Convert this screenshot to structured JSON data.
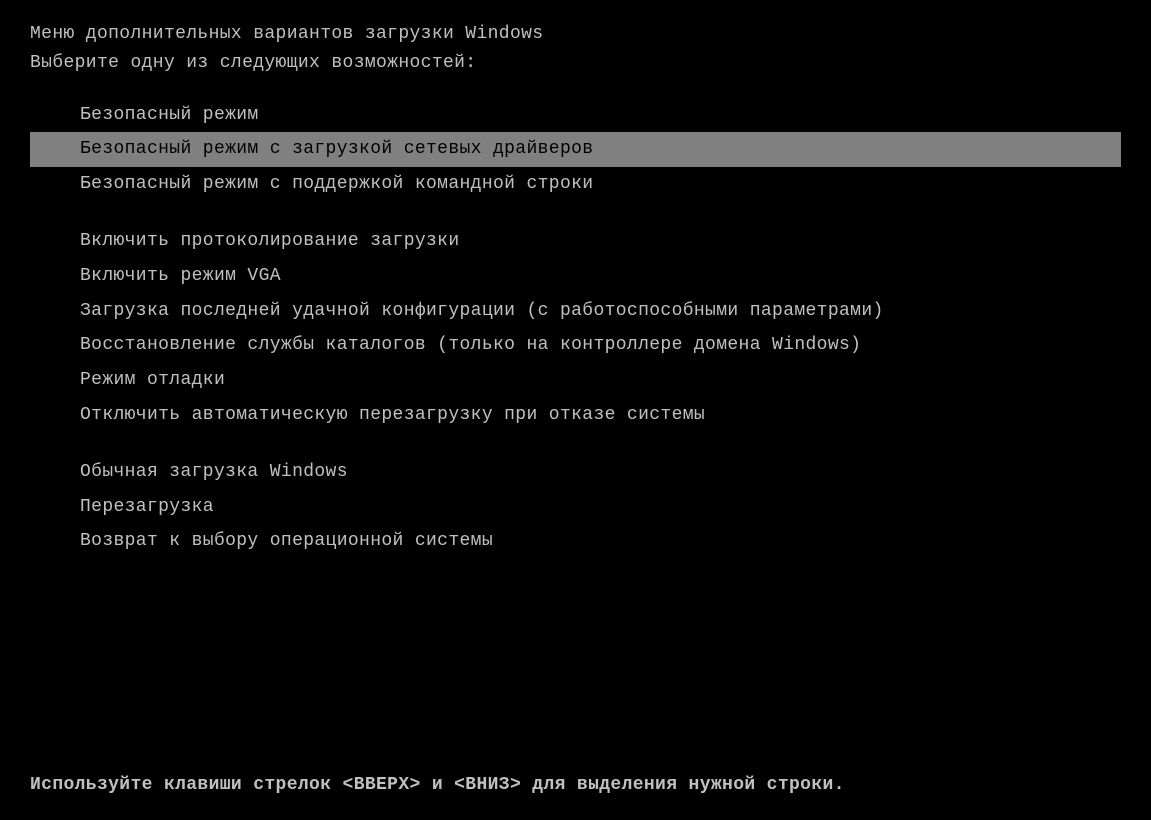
{
  "header": {
    "line1": "Меню дополнительных вариантов загрузки Windows",
    "line2": "Выберите одну из следующих возможностей:"
  },
  "menu": {
    "items": [
      {
        "id": "safe-mode",
        "label": "Безопасный режим",
        "selected": false
      },
      {
        "id": "safe-mode-network",
        "label": "Безопасный режим с загрузкой сетевых драйверов",
        "selected": true
      },
      {
        "id": "safe-mode-cmd",
        "label": "Безопасный режим с поддержкой командной строки",
        "selected": false
      },
      {
        "id": "spacer1",
        "label": "",
        "spacer": true
      },
      {
        "id": "enable-logging",
        "label": "Включить протоколирование загрузки",
        "selected": false
      },
      {
        "id": "enable-vga",
        "label": "Включить режим VGA",
        "selected": false
      },
      {
        "id": "last-known-good",
        "label": "Загрузка последней удачной конфигурации (с работоспособными параметрами)",
        "selected": false
      },
      {
        "id": "restore-directory",
        "label": "Восстановление службы каталогов (только на контроллере домена Windows)",
        "selected": false
      },
      {
        "id": "debug-mode",
        "label": "Режим отладки",
        "selected": false
      },
      {
        "id": "disable-restart",
        "label": "Отключить автоматическую перезагрузку при отказе системы",
        "selected": false
      },
      {
        "id": "spacer2",
        "label": "",
        "spacer": true
      },
      {
        "id": "normal-boot",
        "label": "Обычная загрузка Windows",
        "selected": false
      },
      {
        "id": "restart",
        "label": "Перезагрузка",
        "selected": false
      },
      {
        "id": "return-os",
        "label": "Возврат к выбору операционной системы",
        "selected": false
      }
    ]
  },
  "footer": {
    "text": "Используйте клавиши стрелок <ВВЕРХ> и <ВНИЗ> для выделения нужной строки."
  }
}
